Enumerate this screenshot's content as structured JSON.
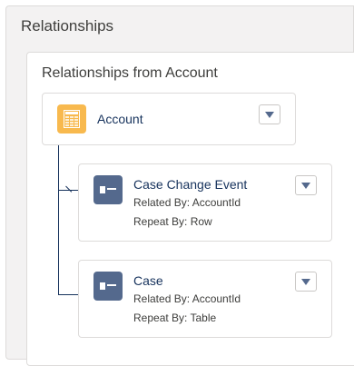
{
  "panel": {
    "title": "Relationships"
  },
  "card": {
    "title": "Relationships from Account"
  },
  "root": {
    "label": "Account",
    "icon": "table-icon"
  },
  "children": [
    {
      "label": "Case Change Event",
      "related_by": "Related By: AccountId",
      "repeat_by": "Repeat By: Row",
      "icon": "record-icon"
    },
    {
      "label": "Case",
      "related_by": "Related By: AccountId",
      "repeat_by": "Repeat By: Table",
      "icon": "record-icon"
    }
  ],
  "colors": {
    "root_icon_bg": "#f8b94e",
    "child_icon_bg": "#54698d",
    "connector": "#16325c"
  }
}
